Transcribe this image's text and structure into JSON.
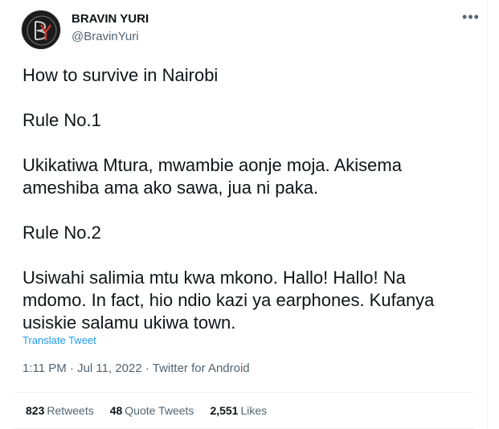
{
  "author": {
    "name": "BRAVIN YURI",
    "handle": "@BravinYuri",
    "avatar_monogram": "BY"
  },
  "tweet": {
    "paragraphs": [
      "How to survive in Nairobi",
      "Rule No.1",
      "Ukikatiwa Mtura, mwambie aonje moja. Akisema ameshiba ama ako sawa, jua ni paka.",
      "Rule No.2",
      "Usiwahi salimia mtu kwa mkono. Hallo! Hallo! Na mdomo. In fact, hio ndio kazi ya earphones. Kufanya usiskie salamu ukiwa town."
    ],
    "translate_label": "Translate Tweet",
    "timestamp": "1:11 PM · Jul 11, 2022 · Twitter for Android"
  },
  "stats": {
    "retweets": {
      "count": "823",
      "label": "Retweets"
    },
    "quote_tweets": {
      "count": "48",
      "label": "Quote Tweets"
    },
    "likes": {
      "count": "2,551",
      "label": "Likes"
    }
  },
  "icons": {
    "more": "more-dots-icon"
  },
  "colors": {
    "link": "#1d9bf0",
    "secondary_text": "#536471",
    "primary_text": "#0f1419"
  }
}
